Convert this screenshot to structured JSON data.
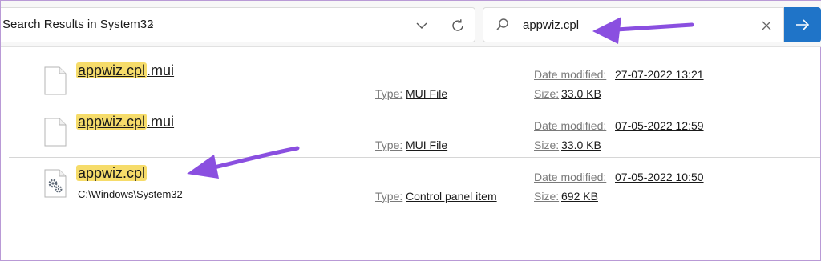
{
  "address": {
    "text": "Search Results in System32",
    "chevron": "›"
  },
  "search": {
    "value": "appwiz.cpl",
    "clear_glyph": "✕"
  },
  "results": [
    {
      "name_highlight": "appwiz.cpl",
      "name_rest": ".mui",
      "path": "",
      "type_label": "Type:",
      "type_value": "MUI File",
      "date_label": "Date modified:",
      "date_value": "27-07-2022 13:21",
      "size_label": "Size:",
      "size_value": "33.0 KB",
      "icon": "document-icon"
    },
    {
      "name_highlight": "appwiz.cpl",
      "name_rest": ".mui",
      "path": "",
      "type_label": "Type:",
      "type_value": "MUI File",
      "date_label": "Date modified:",
      "date_value": "07-05-2022 12:59",
      "size_label": "Size:",
      "size_value": "33.0 KB",
      "icon": "document-icon"
    },
    {
      "name_highlight": "appwiz.cpl",
      "name_rest": "",
      "path": "C:\\Windows\\System32",
      "type_label": "Type:",
      "type_value": "Control panel item",
      "date_label": "Date modified:",
      "date_value": "07-05-2022 10:50",
      "size_label": "Size:",
      "size_value": "692 KB",
      "icon": "settings-file-icon"
    }
  ],
  "colors": {
    "highlight": "#f6dc6a",
    "go_button": "#1f74c8",
    "annotation_arrow": "#8a4fe0",
    "label_gray": "#7a7a7a"
  }
}
